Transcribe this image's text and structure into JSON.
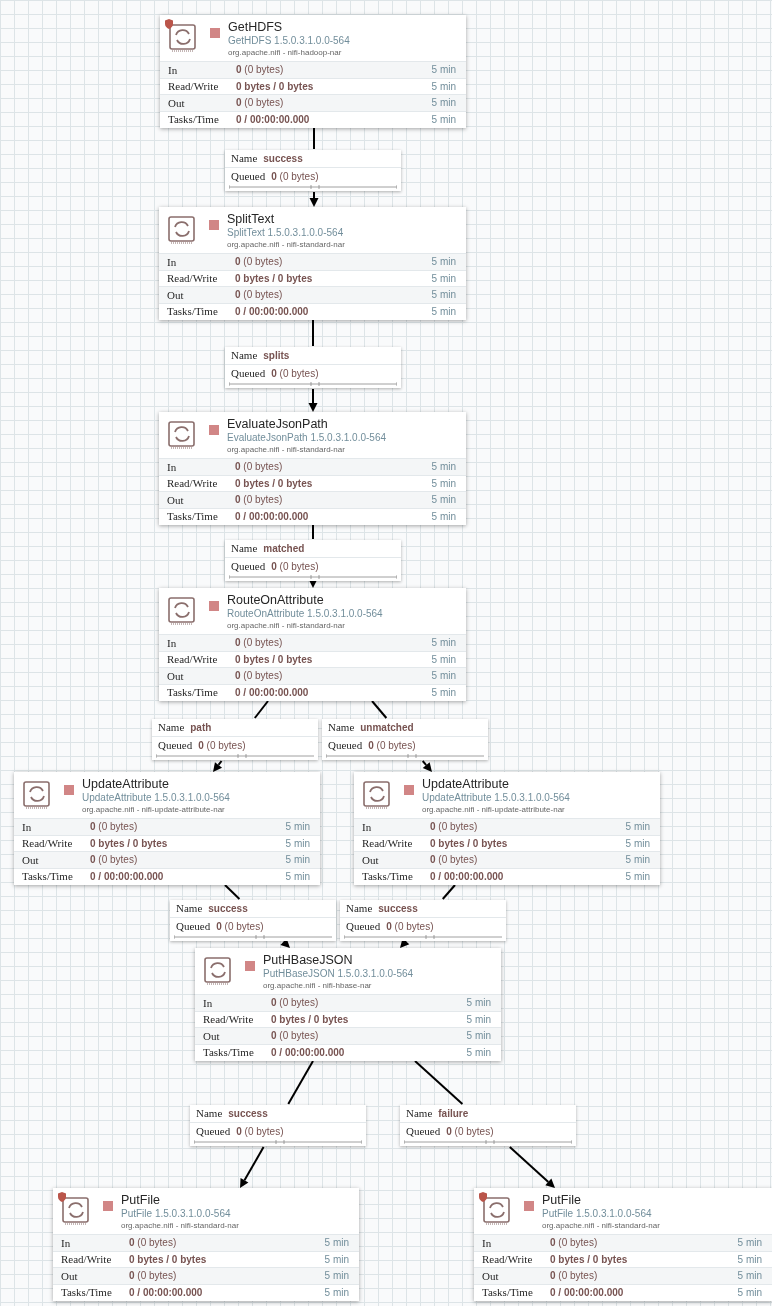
{
  "processors": [
    {
      "name": "GetHDFS",
      "type": "GetHDFS 1.5.0.3.1.0.0-564",
      "bundle": "org.apache.nifi - nifi-hadoop-nar",
      "restricted": true,
      "stopped": true,
      "stats": [
        {
          "label": "In",
          "count": "0",
          "detail": "(0 bytes)",
          "period": "5 min"
        },
        {
          "label": "Read/Write",
          "count": "0 bytes / 0 bytes",
          "period": "5 min"
        },
        {
          "label": "Out",
          "count": "0",
          "detail": "(0 bytes)",
          "period": "5 min"
        },
        {
          "label": "Tasks/Time",
          "count": "0 / 00:00:00.000",
          "period": "5 min"
        }
      ]
    },
    {
      "name": "SplitText",
      "type": "SplitText 1.5.0.3.1.0.0-564",
      "bundle": "org.apache.nifi - nifi-standard-nar",
      "restricted": false,
      "stopped": true,
      "stats": [
        {
          "label": "In",
          "count": "0",
          "detail": "(0 bytes)",
          "period": "5 min"
        },
        {
          "label": "Read/Write",
          "count": "0 bytes / 0 bytes",
          "period": "5 min"
        },
        {
          "label": "Out",
          "count": "0",
          "detail": "(0 bytes)",
          "period": "5 min"
        },
        {
          "label": "Tasks/Time",
          "count": "0 / 00:00:00.000",
          "period": "5 min"
        }
      ]
    },
    {
      "name": "EvaluateJsonPath",
      "type": "EvaluateJsonPath 1.5.0.3.1.0.0-564",
      "bundle": "org.apache.nifi - nifi-standard-nar",
      "restricted": false,
      "stopped": true,
      "stats": [
        {
          "label": "In",
          "count": "0",
          "detail": "(0 bytes)",
          "period": "5 min"
        },
        {
          "label": "Read/Write",
          "count": "0 bytes / 0 bytes",
          "period": "5 min"
        },
        {
          "label": "Out",
          "count": "0",
          "detail": "(0 bytes)",
          "period": "5 min"
        },
        {
          "label": "Tasks/Time",
          "count": "0 / 00:00:00.000",
          "period": "5 min"
        }
      ]
    },
    {
      "name": "RouteOnAttribute",
      "type": "RouteOnAttribute 1.5.0.3.1.0.0-564",
      "bundle": "org.apache.nifi - nifi-standard-nar",
      "restricted": false,
      "stopped": true,
      "stats": [
        {
          "label": "In",
          "count": "0",
          "detail": "(0 bytes)",
          "period": "5 min"
        },
        {
          "label": "Read/Write",
          "count": "0 bytes / 0 bytes",
          "period": "5 min"
        },
        {
          "label": "Out",
          "count": "0",
          "detail": "(0 bytes)",
          "period": "5 min"
        },
        {
          "label": "Tasks/Time",
          "count": "0 / 00:00:00.000",
          "period": "5 min"
        }
      ]
    },
    {
      "name": "UpdateAttribute",
      "type": "UpdateAttribute 1.5.0.3.1.0.0-564",
      "bundle": "org.apache.nifi - nifi-update-attribute-nar",
      "restricted": false,
      "stopped": true,
      "stats": [
        {
          "label": "In",
          "count": "0",
          "detail": "(0 bytes)",
          "period": "5 min"
        },
        {
          "label": "Read/Write",
          "count": "0 bytes / 0 bytes",
          "period": "5 min"
        },
        {
          "label": "Out",
          "count": "0",
          "detail": "(0 bytes)",
          "period": "5 min"
        },
        {
          "label": "Tasks/Time",
          "count": "0 / 00:00:00.000",
          "period": "5 min"
        }
      ]
    },
    {
      "name": "UpdateAttribute",
      "type": "UpdateAttribute 1.5.0.3.1.0.0-564",
      "bundle": "org.apache.nifi - nifi-update-attribute-nar",
      "restricted": false,
      "stopped": true,
      "stats": [
        {
          "label": "In",
          "count": "0",
          "detail": "(0 bytes)",
          "period": "5 min"
        },
        {
          "label": "Read/Write",
          "count": "0 bytes / 0 bytes",
          "period": "5 min"
        },
        {
          "label": "Out",
          "count": "0",
          "detail": "(0 bytes)",
          "period": "5 min"
        },
        {
          "label": "Tasks/Time",
          "count": "0 / 00:00:00.000",
          "period": "5 min"
        }
      ]
    },
    {
      "name": "PutHBaseJSON",
      "type": "PutHBaseJSON 1.5.0.3.1.0.0-564",
      "bundle": "org.apache.nifi - nifi-hbase-nar",
      "restricted": false,
      "stopped": true,
      "stats": [
        {
          "label": "In",
          "count": "0",
          "detail": "(0 bytes)",
          "period": "5 min"
        },
        {
          "label": "Read/Write",
          "count": "0 bytes / 0 bytes",
          "period": "5 min"
        },
        {
          "label": "Out",
          "count": "0",
          "detail": "(0 bytes)",
          "period": "5 min"
        },
        {
          "label": "Tasks/Time",
          "count": "0 / 00:00:00.000",
          "period": "5 min"
        }
      ]
    },
    {
      "name": "PutFile",
      "type": "PutFile 1.5.0.3.1.0.0-564",
      "bundle": "org.apache.nifi - nifi-standard-nar",
      "restricted": true,
      "stopped": true,
      "stats": [
        {
          "label": "In",
          "count": "0",
          "detail": "(0 bytes)",
          "period": "5 min"
        },
        {
          "label": "Read/Write",
          "count": "0 bytes / 0 bytes",
          "period": "5 min"
        },
        {
          "label": "Out",
          "count": "0",
          "detail": "(0 bytes)",
          "period": "5 min"
        },
        {
          "label": "Tasks/Time",
          "count": "0 / 00:00:00.000",
          "period": "5 min"
        }
      ]
    },
    {
      "name": "PutFile",
      "type": "PutFile 1.5.0.3.1.0.0-564",
      "bundle": "org.apache.nifi - nifi-standard-nar",
      "restricted": true,
      "stopped": true,
      "stats": [
        {
          "label": "In",
          "count": "0",
          "detail": "(0 bytes)",
          "period": "5 min"
        },
        {
          "label": "Read/Write",
          "count": "0 bytes / 0 bytes",
          "period": "5 min"
        },
        {
          "label": "Out",
          "count": "0",
          "detail": "(0 bytes)",
          "period": "5 min"
        },
        {
          "label": "Tasks/Time",
          "count": "0 / 00:00:00.000",
          "period": "5 min"
        }
      ]
    }
  ],
  "connections": [
    {
      "name_label": "Name",
      "name": "success",
      "queued_label": "Queued",
      "count": "0",
      "detail": "(0 bytes)"
    },
    {
      "name_label": "Name",
      "name": "splits",
      "queued_label": "Queued",
      "count": "0",
      "detail": "(0 bytes)"
    },
    {
      "name_label": "Name",
      "name": "matched",
      "queued_label": "Queued",
      "count": "0",
      "detail": "(0 bytes)"
    },
    {
      "name_label": "Name",
      "name": "path",
      "queued_label": "Queued",
      "count": "0",
      "detail": "(0 bytes)"
    },
    {
      "name_label": "Name",
      "name": "unmatched",
      "queued_label": "Queued",
      "count": "0",
      "detail": "(0 bytes)"
    },
    {
      "name_label": "Name",
      "name": "success",
      "queued_label": "Queued",
      "count": "0",
      "detail": "(0 bytes)"
    },
    {
      "name_label": "Name",
      "name": "success",
      "queued_label": "Queued",
      "count": "0",
      "detail": "(0 bytes)"
    },
    {
      "name_label": "Name",
      "name": "success",
      "queued_label": "Queued",
      "count": "0",
      "detail": "(0 bytes)"
    },
    {
      "name_label": "Name",
      "name": "failure",
      "queued_label": "Queued",
      "count": "0",
      "detail": "(0 bytes)"
    }
  ]
}
